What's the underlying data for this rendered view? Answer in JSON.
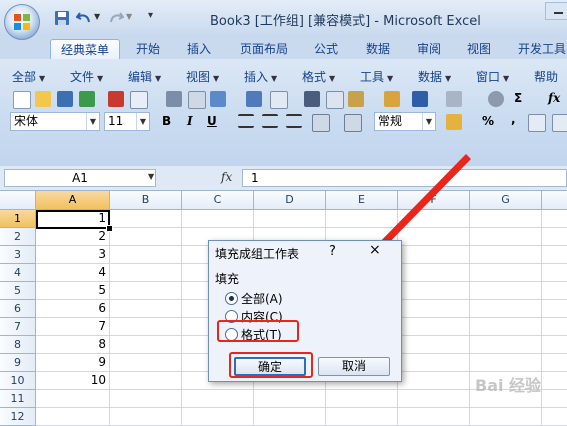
{
  "window": {
    "title": "Book3  [工作组]  [兼容模式] - Microsoft Excel"
  },
  "tabs": [
    "经典菜单",
    "开始",
    "插入",
    "页面布局",
    "公式",
    "数据",
    "审阅",
    "视图",
    "开发工具"
  ],
  "active_tab": "经典菜单",
  "menus": [
    "全部",
    "文件",
    "编辑",
    "视图",
    "插入",
    "格式",
    "工具",
    "数据",
    "窗口",
    "帮助"
  ],
  "toolbar": {
    "font": "宋体",
    "size": "11",
    "bold": "B",
    "italic": "I",
    "underline": "U",
    "number_format": "常规",
    "percent": "%",
    "comma": ",",
    "sigma": "Σ",
    "fx": "fx"
  },
  "formula_bar": {
    "name_box": "A1",
    "fx_label": "fx",
    "value": "1"
  },
  "columns": [
    "A",
    "B",
    "C",
    "D",
    "E",
    "F",
    "G"
  ],
  "rows": [
    "1",
    "2",
    "3",
    "4",
    "5",
    "6",
    "7",
    "8",
    "9",
    "10",
    "11",
    "12"
  ],
  "cells_A": [
    "1",
    "2",
    "3",
    "4",
    "5",
    "6",
    "7",
    "8",
    "9",
    "10",
    "",
    ""
  ],
  "dialog": {
    "title": "填充成组工作表",
    "help": "?",
    "close": "×",
    "group_label": "填充",
    "options": [
      "全部(A)",
      "内容(C)",
      "格式(T)"
    ],
    "selected_option": "全部(A)",
    "ok": "确定",
    "cancel": "取消"
  },
  "watermark": "Bai 经验",
  "colors": {
    "annotation": "#e8261b",
    "selection_header": "#f1c15f",
    "ribbon": "#c9dbf0"
  }
}
